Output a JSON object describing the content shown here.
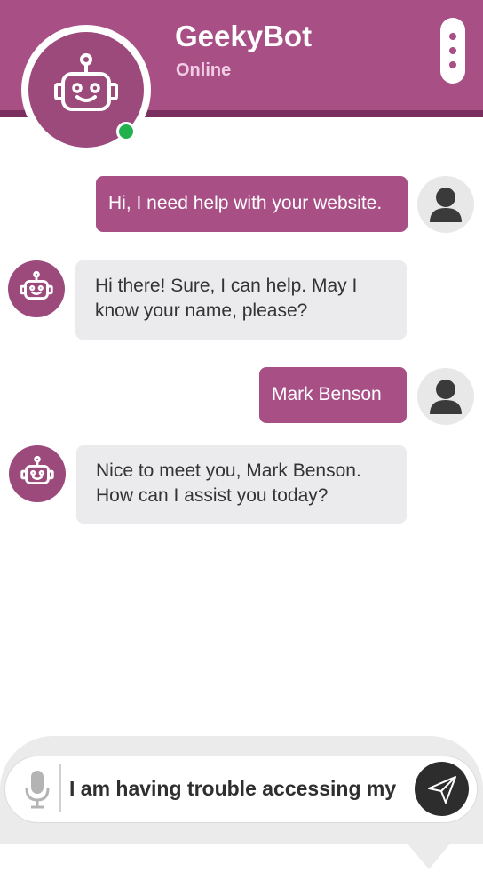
{
  "header": {
    "bot_name": "GeekyBot",
    "status": "Online",
    "status_color": "#22b14c",
    "brand_color": "#a84f86",
    "icons": [
      "robot-icon",
      "kebab-menu-icon"
    ]
  },
  "messages": [
    {
      "sender": "user",
      "text": "Hi, I need help with your website."
    },
    {
      "sender": "bot",
      "text": "Hi there! Sure, I can help. May I know your name, please?"
    },
    {
      "sender": "user",
      "text": "Mark Benson"
    },
    {
      "sender": "bot",
      "text": "Nice to meet you, Mark Benson. How can I assist you today?"
    }
  ],
  "composer": {
    "input_value": "I am having trouble accessing my",
    "icons": [
      "microphone-icon",
      "send-icon"
    ]
  }
}
